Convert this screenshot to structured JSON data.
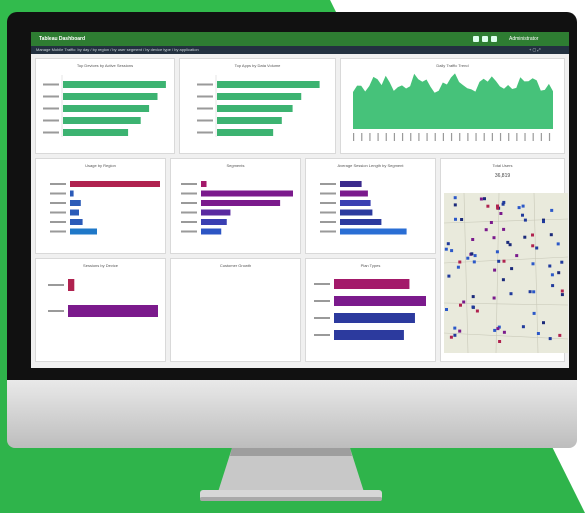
{
  "app": {
    "title": "Tableau Dashboard",
    "filter_text": "Manage Mobile Traffic: by day / by region / by user segment / by device type / by application",
    "user_label": "Administrator",
    "controls": "+ ▢ ⤢"
  },
  "panels": {
    "p1": {
      "title": "Top Devices by Active Sessions",
      "values": [
        98,
        90,
        82,
        74,
        62
      ],
      "color": "#3cb371"
    },
    "p2": {
      "title": "Top Apps by Data Volume",
      "values": [
        95,
        78,
        70,
        60,
        52
      ],
      "color": "#3cb371"
    },
    "p3": {
      "title": "Daily Traffic Trend",
      "color": "#46c27a"
    },
    "p4": {
      "title": "Usage by Region",
      "values": [
        100,
        4,
        12,
        10,
        14,
        30
      ],
      "colors": [
        "#b0224f",
        "#2b5bb8",
        "#2b5bb8",
        "#2b5bb8",
        "#2b5bb8",
        "#1f78c8"
      ]
    },
    "p5": {
      "title": "Segments",
      "values": [
        6,
        100,
        86,
        32,
        28,
        22
      ],
      "colors": [
        "#a3196a",
        "#7b1a8c",
        "#7b1a8c",
        "#5a2aa0",
        "#3a3fb2",
        "#2c55c4"
      ]
    },
    "p6": {
      "title": "Average Session Length by Segment",
      "values": [
        24,
        31,
        34,
        36,
        46,
        74
      ],
      "colors": [
        "#3b2a8c",
        "#7b1a8c",
        "#3a3fb2",
        "#2c3a9e",
        "#2c3a9e",
        "#2a6ed4"
      ]
    },
    "p7": {
      "title": "Total Users",
      "value": "36,819"
    },
    "p8": {
      "title": "Sessions by Device",
      "values": [
        7,
        100
      ],
      "colors": [
        "#b0224f",
        "#7b1a8c"
      ]
    },
    "p9": {
      "title": "Customer Growth"
    },
    "p10": {
      "title": "Plan Types",
      "values": [
        82,
        100,
        88,
        76
      ],
      "colors": [
        "#a3196a",
        "#7b1a8c",
        "#2c3a9e",
        "#2c3a9e"
      ]
    }
  },
  "colors": {
    "brand_green": "#2fb44b",
    "appbar": "#2e7d32"
  }
}
